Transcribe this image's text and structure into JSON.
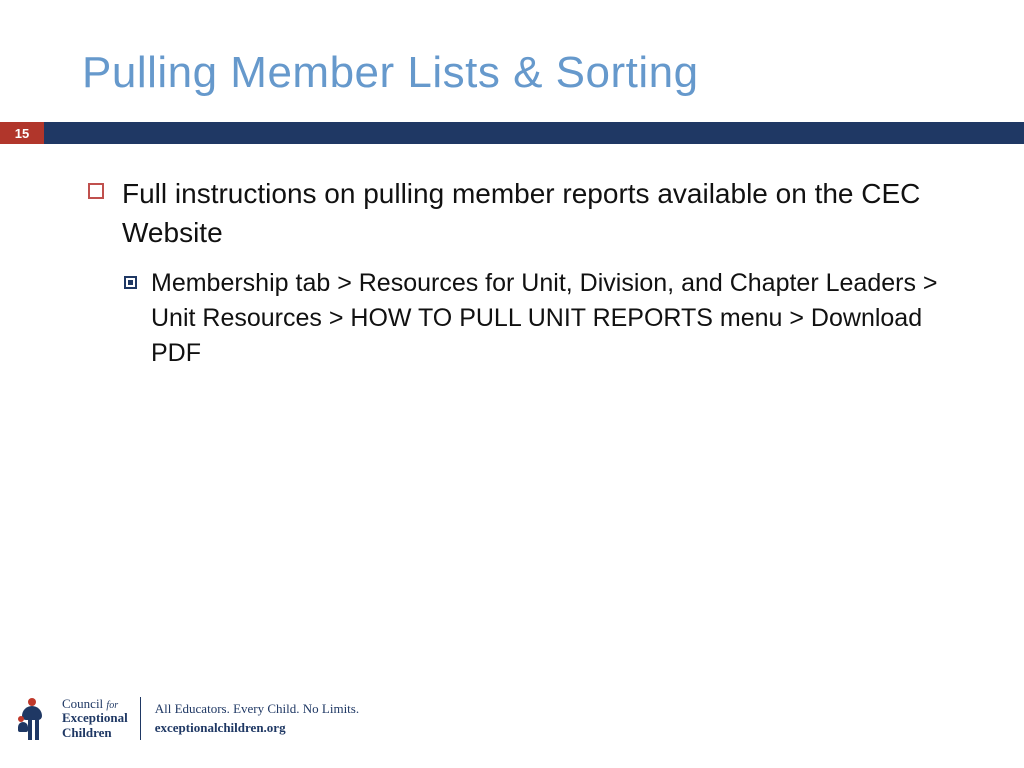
{
  "slide": {
    "title": "Pulling Member Lists & Sorting",
    "page_number": "15",
    "bullets": [
      {
        "text": "Full instructions on pulling member reports available on the CEC Website",
        "sub": [
          {
            "text": "Membership tab > Resources for Unit, Division, and Chapter Leaders > Unit Resources > HOW TO PULL UNIT REPORTS menu > Download PDF"
          }
        ]
      }
    ]
  },
  "footer": {
    "org_line1_a": "Council",
    "org_line1_b": "for",
    "org_line2": "Exceptional",
    "org_line3": "Children",
    "tagline": "All Educators. Every Child. No Limits.",
    "url": "exceptionalchildren.org"
  }
}
